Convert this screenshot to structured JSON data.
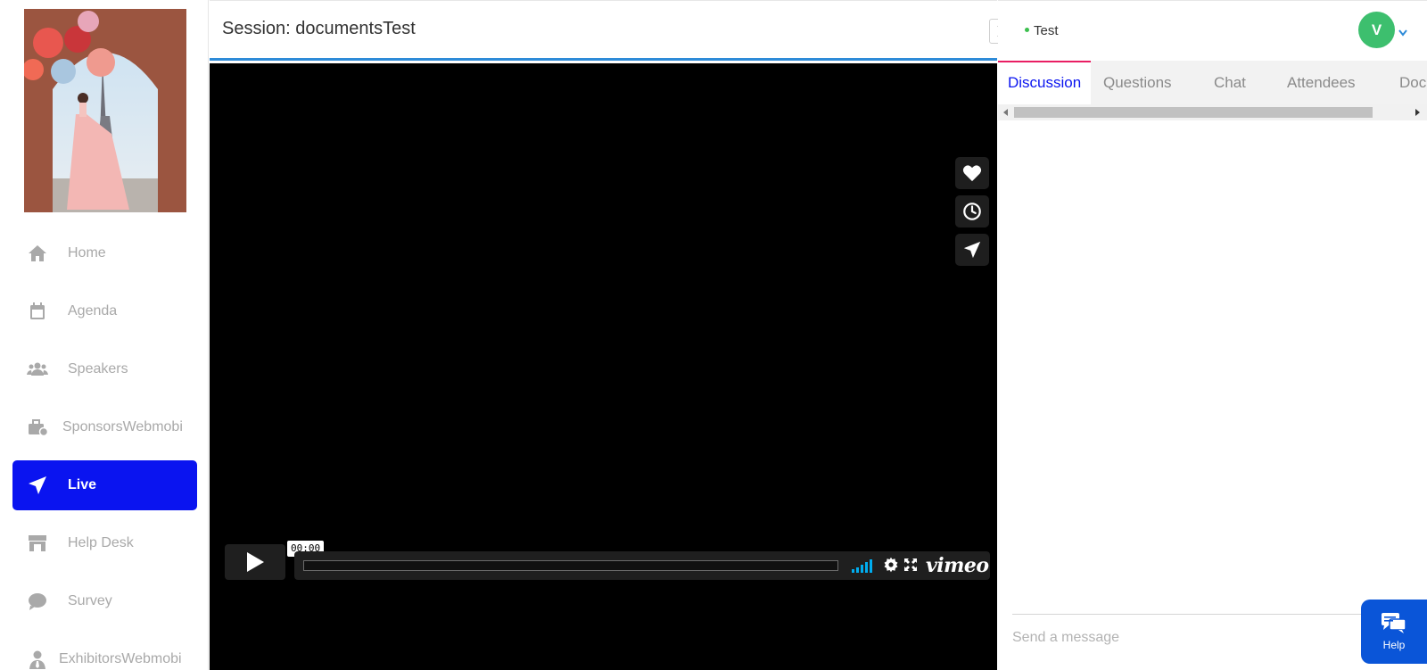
{
  "session": {
    "title": "Session: documentsTest"
  },
  "sidebar": {
    "items": [
      {
        "label": "Home",
        "icon": "home-icon",
        "active": false
      },
      {
        "label": "Agenda",
        "icon": "calendar-icon",
        "active": false
      },
      {
        "label": "Speakers",
        "icon": "users-icon",
        "active": false
      },
      {
        "label": "SponsorsWebmobi",
        "icon": "briefcase-icon",
        "active": false
      },
      {
        "label": "Live",
        "icon": "paper-plane-icon",
        "active": true
      },
      {
        "label": "Help Desk",
        "icon": "store-icon",
        "active": false
      },
      {
        "label": "Survey",
        "icon": "comment-icon",
        "active": false
      },
      {
        "label": "ExhibitorsWebmobi",
        "icon": "user-tie-icon",
        "active": false
      }
    ]
  },
  "player": {
    "time": "00:00",
    "brand": "vimeo",
    "progress": 0
  },
  "panel": {
    "status_name": "Test",
    "avatar_initial": "V",
    "tabs": [
      {
        "label": "Discussion",
        "active": true
      },
      {
        "label": "Questions",
        "active": false
      },
      {
        "label": "Chat",
        "active": false
      },
      {
        "label": "Attendees",
        "active": false
      },
      {
        "label": "Doc",
        "active": false
      }
    ],
    "message_placeholder": "Send a message",
    "help_label": "Help"
  },
  "colors": {
    "accent_blue": "#0a14f0",
    "header_underline": "#2e8bd8",
    "status_green": "#3cbf4e",
    "avatar_green": "#3dbf6e",
    "tab_active_border": "#e91e63",
    "help_blue": "#0a55d8",
    "vimeo_blue": "#00adef"
  }
}
